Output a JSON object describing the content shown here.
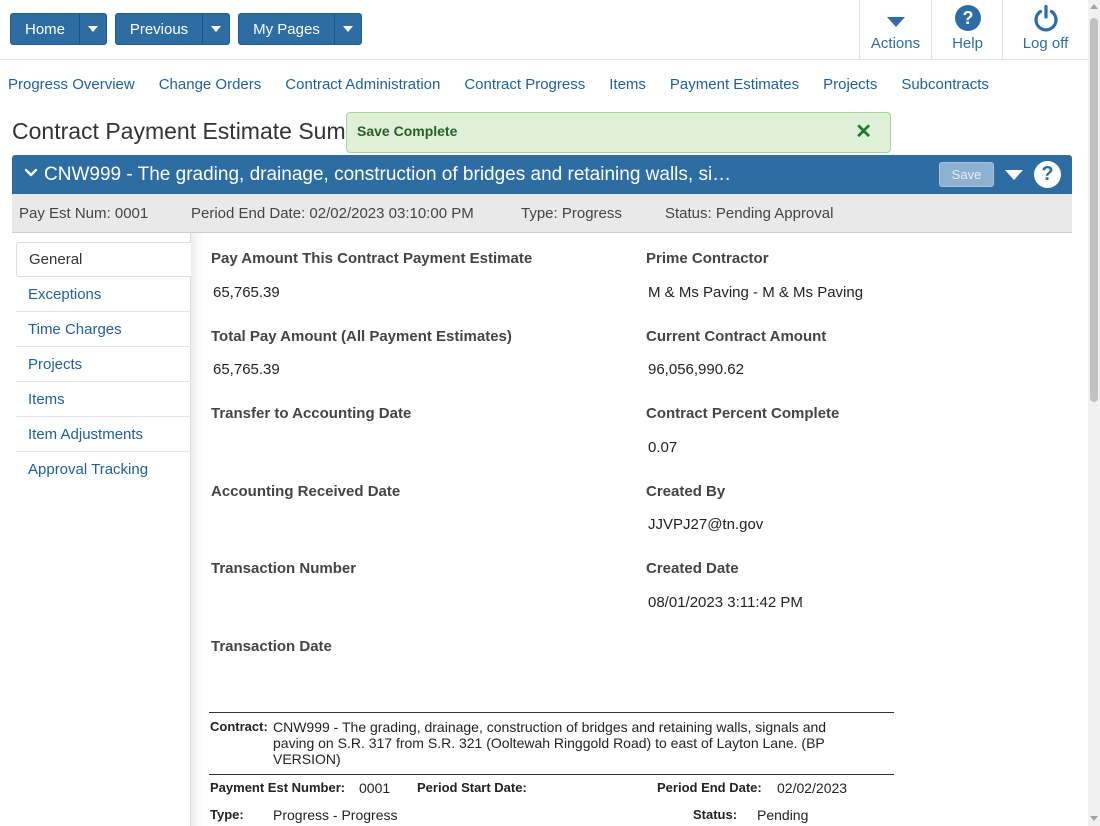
{
  "topnav": {
    "home": "Home",
    "previous": "Previous",
    "my_pages": "My Pages",
    "actions": "Actions",
    "help": "Help",
    "log_off": "Log off"
  },
  "menu": [
    "Progress Overview",
    "Change Orders",
    "Contract Administration",
    "Contract Progress",
    "Items",
    "Payment Estimates",
    "Projects",
    "Subcontracts"
  ],
  "page_title": "Contract Payment Estimate Sum",
  "toast": {
    "message": "Save Complete",
    "close": "✕"
  },
  "header": {
    "title": "CNW999 - The grading, drainage, construction of bridges and retaining walls, si…",
    "save": "Save",
    "help_glyph": "?"
  },
  "subinfo": {
    "pay_est_num": "Pay Est Num: 0001",
    "period_end": "Period End Date: 02/02/2023 03:10:00 PM",
    "type": "Type: Progress",
    "status": "Status: Pending Approval"
  },
  "sidebar": [
    "General",
    "Exceptions",
    "Time Charges",
    "Projects",
    "Items",
    "Item Adjustments",
    "Approval Tracking"
  ],
  "fields": {
    "pay_amount_label": "Pay Amount This Contract Payment Estimate",
    "pay_amount_value": "65,765.39",
    "total_pay_label": "Total Pay Amount (All Payment Estimates)",
    "total_pay_value": "65,765.39",
    "transfer_label": "Transfer to Accounting Date",
    "accounting_label": "Accounting Received Date",
    "transaction_number_label": "Transaction Number",
    "transaction_date_label": "Transaction Date",
    "prime_label": "Prime Contractor",
    "prime_value": "M & Ms Paving - M & Ms Paving",
    "current_amount_label": "Current Contract Amount",
    "current_amount_value": "96,056,990.62",
    "percent_label": "Contract Percent Complete",
    "percent_value": "0.07",
    "created_by_label": "Created By",
    "created_by_value": "JJVPJ27@tn.gov",
    "created_date_label": "Created Date",
    "created_date_value": "08/01/2023 3:11:42 PM"
  },
  "report": {
    "contract_label": "Contract:",
    "contract_value": "CNW999 - The grading, drainage, construction of bridges and retaining walls, signals and paving on S.R. 317 from S.R. 321 (Ooltewah Ringgold Road) to east of Layton Lane. (BP VERSION)",
    "pay_est_label": "Payment Est Number:",
    "pay_est_value": "0001",
    "period_start_label": "Period Start Date:",
    "period_end_label": "Period End Date:",
    "period_end_value": "02/02/2023",
    "type_label": "Type:",
    "type_value": "Progress - Progress",
    "status_label": "Status:",
    "status_value": "Pending"
  }
}
